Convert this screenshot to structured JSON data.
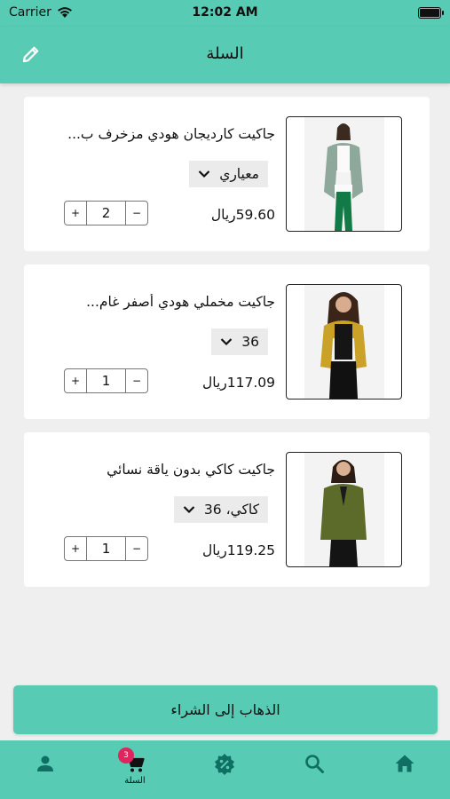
{
  "status_bar": {
    "carrier": "Carrier",
    "time": "12:02 AM"
  },
  "header": {
    "title": "السلة"
  },
  "cart_items": [
    {
      "name": "جاكيت كارديجان هودي مزخرف ب...",
      "variant": "معياري",
      "price": "59.60ريال",
      "quantity": "2"
    },
    {
      "name": "جاكيت مخملي هودي أصفر غام...",
      "variant": "36",
      "price": "117.09ريال",
      "quantity": "1"
    },
    {
      "name": "جاكيت كاكي بدون ياقة نسائي",
      "variant": "كاكي، 36",
      "price": "119.25ريال",
      "quantity": "1"
    }
  ],
  "stepper": {
    "plus": "+",
    "minus": "−"
  },
  "checkout": {
    "label": "الذهاب إلى الشراء"
  },
  "tabbar": {
    "cart_label": "السلة",
    "cart_badge": "3",
    "icons": [
      "person-icon",
      "cart-icon",
      "discount-icon",
      "search-icon",
      "home-icon"
    ]
  },
  "colors": {
    "accent": "#57cbb3",
    "badge": "#e0245e",
    "background": "#efefef"
  }
}
